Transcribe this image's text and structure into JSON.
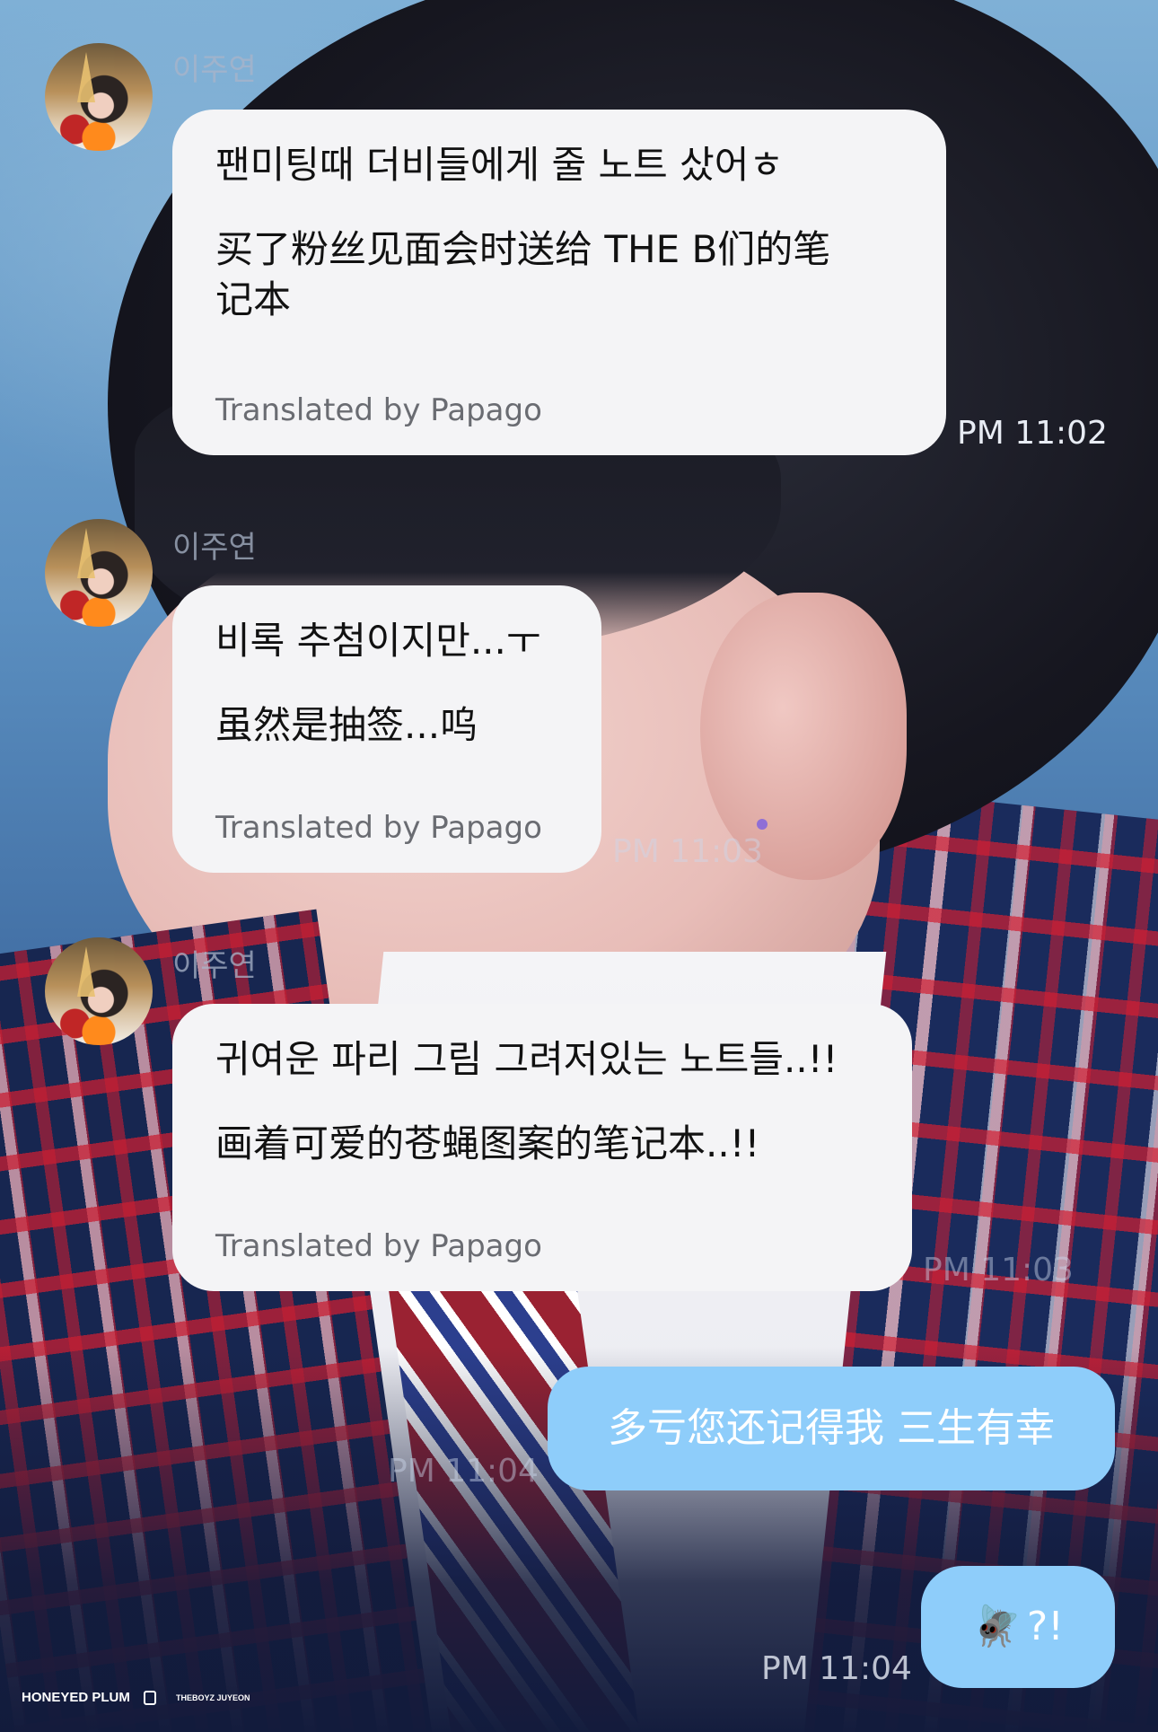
{
  "sender_name": "이주연",
  "messages": [
    {
      "korean": "팬미팅때 더비들에게 줄 노트 샀어ㅎ",
      "chinese_1": "买了粉丝见面会时送给 THE B们的笔",
      "chinese_2": "记本",
      "credit": "Translated by Papago",
      "time": "PM 11:02"
    },
    {
      "korean": "비록 추첨이지만...ㅜ",
      "chinese_1": "虽然是抽签...呜",
      "credit": "Translated by Papago",
      "time": "PM 11:03"
    },
    {
      "korean": "귀여운 파리 그림 그려저있는 노트들..!!",
      "chinese_1": "画着可爱的苍蝇图案的笔记本..!!",
      "credit": "Translated by Papago",
      "time": "PM 11:03"
    }
  ],
  "replies": [
    {
      "text": "多亏您还记得我 三生有幸",
      "time": "PM 11:04"
    },
    {
      "emoji": "🪰",
      "text": "?!",
      "time": "PM 11:04"
    }
  ],
  "watermark": {
    "left": "HONEYED PLUM",
    "right": "THEBOYZ JUYEON"
  },
  "colors": {
    "received_bubble": "#f4f4f6",
    "sent_bubble": "#8ecdfa",
    "credit_text": "#6a6c72"
  }
}
